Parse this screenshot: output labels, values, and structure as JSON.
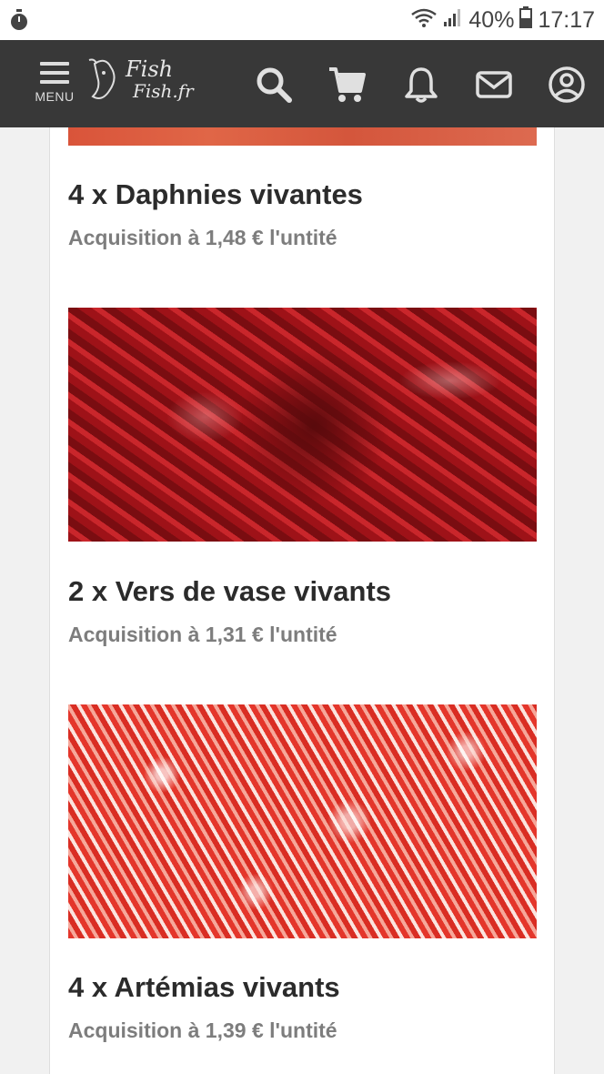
{
  "status_bar": {
    "battery_percent": "40%",
    "time": "17:17"
  },
  "nav": {
    "menu_label": "MENU",
    "logo_line1": "Fish",
    "logo_line2": "Fish.fr",
    "icons": [
      "search-icon",
      "cart-icon",
      "bell-icon",
      "mail-icon",
      "account-icon"
    ]
  },
  "products": [
    {
      "title": "4 x Daphnies vivantes",
      "price": "Acquisition à 1,48 € l'untité"
    },
    {
      "title": "2 x Vers de vase vivants",
      "price": "Acquisition à 1,31 € l'untité"
    },
    {
      "title": "4 x Artémias vivants",
      "price": "Acquisition à 1,39 € l'untité"
    }
  ],
  "colors": {
    "navbar": "#282828",
    "title_text": "#2b2b2b",
    "price_text": "#7d7d7d"
  }
}
